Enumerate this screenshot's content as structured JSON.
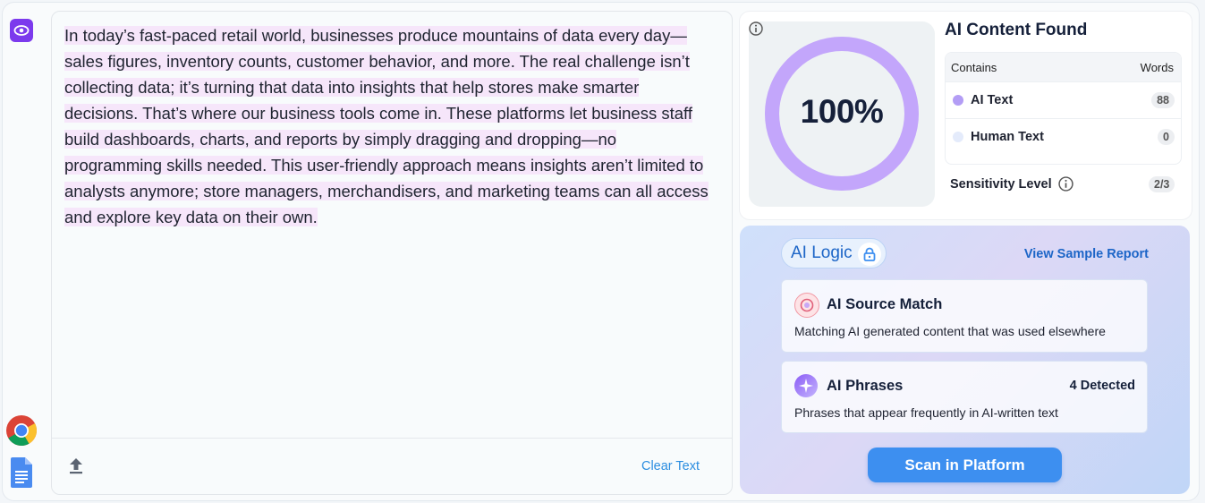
{
  "editor": {
    "text": "In today’s fast-paced retail world, businesses produce mountains of data every day—sales figures, inventory counts, customer behavior, and more. The real challenge isn’t collecting data; it’s turning that data into insights that help stores make smarter decisions. That’s where our business tools come in. These platforms let business staff build dashboards, charts, and reports by simply dragging and dropping—no programming skills needed. This user-friendly approach means insights aren’t limited to analysts anymore; store managers, merchandisers, and marketing teams can all access and explore key data on their own.",
    "clear_label": "Clear Text"
  },
  "result": {
    "score": "100%",
    "score_fraction": 1.0,
    "title": "AI Content Found",
    "col_contains": "Contains",
    "col_words": "Words",
    "rows": [
      {
        "label": "AI Text",
        "count": "88",
        "color": "#b39df5"
      },
      {
        "label": "Human Text",
        "count": "0",
        "color": "#e4ebfb"
      }
    ],
    "sensitivity_label": "Sensitivity Level",
    "sensitivity_value": "2/3"
  },
  "logic": {
    "pill_label": "AI Logic",
    "sample_link": "View Sample Report",
    "cards": [
      {
        "title": "AI Source Match",
        "desc": "Matching AI generated content that was used elsewhere"
      },
      {
        "title": "AI Phrases",
        "desc": "Phrases that appear frequently in AI-written text",
        "badge": "4 Detected"
      }
    ],
    "scan_button": "Scan in Platform"
  },
  "colors": {
    "accent": "#3d8ff0",
    "ring": "#c3a6fb",
    "brand_purple": "#7c3aed"
  }
}
